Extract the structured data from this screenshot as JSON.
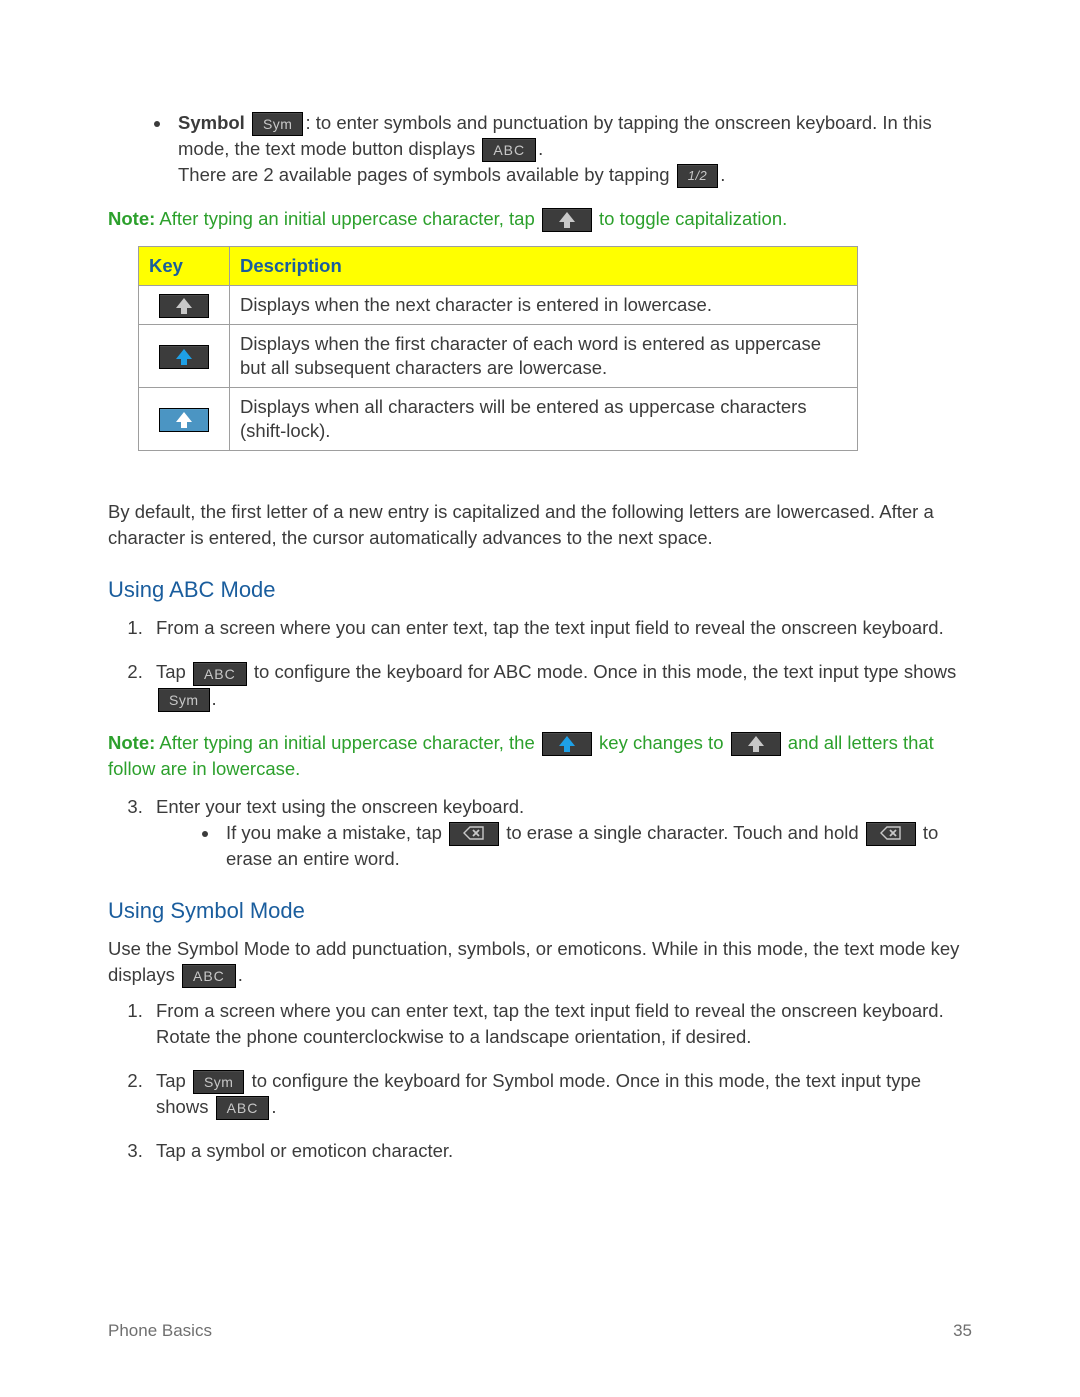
{
  "symbol_bullet": {
    "label": "Symbol",
    "sym_key": "Sym",
    "text_a": ": to enter symbols and punctuation by tapping the onscreen keyboard. In this mode, the text mode button displays ",
    "abc_key": "ABC",
    "period": ".",
    "line2_a": "There are 2 available pages of symbols available by tapping ",
    "half_key": "1/2"
  },
  "note1": {
    "label": "Note:",
    "a": " After typing an initial uppercase character, tap ",
    "b": " to toggle capitalization."
  },
  "table": {
    "head_key": "Key",
    "head_desc": "Description",
    "row1_desc": "Displays when the next character is entered in lowercase.",
    "row2_desc": "Displays when the first character of each word is entered as uppercase but all subsequent characters are lowercase.",
    "row3_desc": "Displays when all characters will be entered as uppercase characters (shift-lock)."
  },
  "para1": "By default, the first letter of a new entry is capitalized and the following letters are lowercased. After a character is entered, the cursor automatically advances to the next space.",
  "heading_abc": "Using ABC Mode",
  "abc_steps": {
    "s1": "From a screen where you can enter text, tap the text input field to reveal the onscreen keyboard.",
    "s2_a": "Tap ",
    "s2_abc": "ABC",
    "s2_b": " to configure the keyboard for ABC mode. Once in this mode, the text input type shows ",
    "s2_sym": "Sym",
    "period": ".",
    "s3": "Enter your text using the onscreen keyboard.",
    "s3_sub_a": "If you make a mistake, tap ",
    "s3_sub_b": " to erase a single character. Touch and hold ",
    "s3_sub_c": " to erase an entire word."
  },
  "note2": {
    "label": "Note:",
    "a": " After typing an initial uppercase character, the ",
    "b": " key changes to ",
    "c": " and all letters that follow are in lowercase."
  },
  "heading_sym": "Using Symbol Mode",
  "sym_intro_a": "Use the Symbol Mode to add punctuation, symbols, or emoticons. While in this mode, the text mode key displays ",
  "sym_intro_abc": "ABC",
  "sym_period": ".",
  "sym_steps": {
    "s1": "From a screen where you can enter text, tap the text input field to reveal the onscreen keyboard. Rotate the phone counterclockwise to a landscape orientation, if desired.",
    "s2_a": "Tap ",
    "s2_sym": "Sym",
    "s2_b": " to configure the keyboard for Symbol mode. Once in this mode, the text input type shows ",
    "s2_abc": "ABC",
    "period": ".",
    "s3": "Tap a symbol or emoticon character."
  },
  "footer": {
    "left": "Phone Basics",
    "right": "35"
  }
}
